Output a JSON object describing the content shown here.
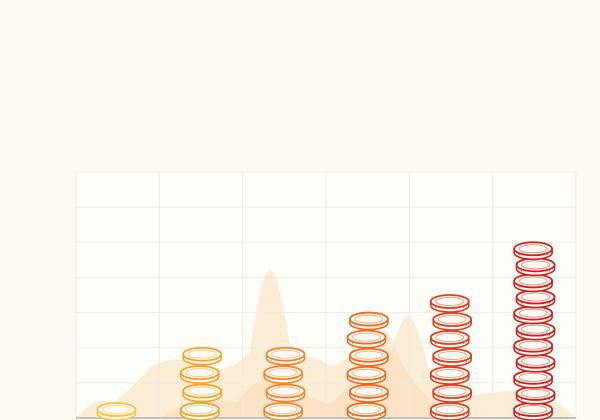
{
  "colors": {
    "background": "#fffaf1",
    "plot_background": "#fffdf8",
    "grid": "#f0ebe2",
    "axis": "#c4c0b8",
    "mountains": "#fbe7cc",
    "stack_gradient": [
      "#fbc13a",
      "#f9a12a",
      "#f5832c",
      "#ef6a1e",
      "#dc4020",
      "#cf1f1c"
    ]
  },
  "icons": {
    "mark": "coin-stack-icon"
  },
  "chart_data": {
    "type": "bar",
    "title": "",
    "xlabel": "",
    "ylabel": "",
    "categories": [
      "",
      "",
      "",
      "",
      "",
      ""
    ],
    "series": [
      {
        "values": [
          1,
          4,
          4,
          6,
          7,
          10
        ]
      }
    ],
    "ylim": [
      0,
      14
    ],
    "grid": true,
    "legend": "none"
  }
}
